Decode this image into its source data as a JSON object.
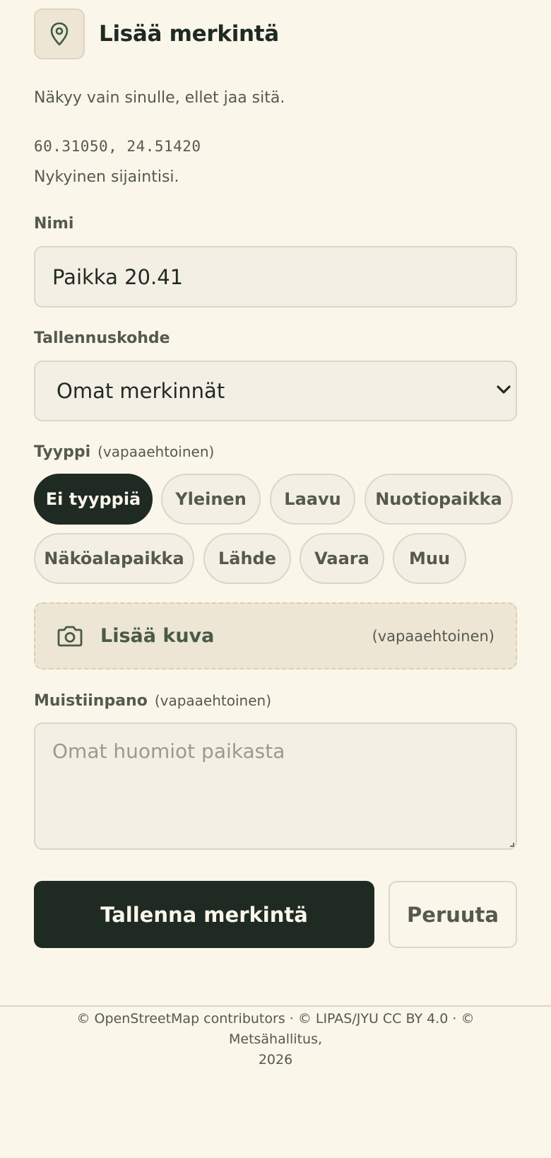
{
  "header": {
    "title": "Lisää merkintä",
    "icon": "map-pin-icon"
  },
  "description": "Näkyy vain sinulle, ellet jaa sitä.",
  "location": {
    "coords": "60.31050, 24.51420",
    "note": "Nykyinen sijaintisi."
  },
  "name_field": {
    "label": "Nimi",
    "value": "Paikka 20.41"
  },
  "target_field": {
    "label": "Tallennuskohde",
    "value": "Omat merkinnät"
  },
  "type_field": {
    "label": "Tyyppi",
    "optional": "(vapaaehtoinen)",
    "options": [
      "Ei tyyppiä",
      "Yleinen",
      "Laavu",
      "Nuotiopaikka",
      "Näköalapaikka",
      "Lähde",
      "Vaara",
      "Muu"
    ],
    "selected": "Ei tyyppiä"
  },
  "photo": {
    "label": "Lisää kuva",
    "optional": "(vapaaehtoinen)",
    "icon": "camera-icon"
  },
  "note_field": {
    "label": "Muistiinpano",
    "optional": "(vapaaehtoinen)",
    "placeholder": "Omat huomiot paikasta"
  },
  "actions": {
    "save": "Tallenna merkintä",
    "cancel": "Peruuta"
  },
  "footer": {
    "attribution_line1": "© OpenStreetMap contributors · © LIPAS/JYU CC BY 4.0 · © Metsähallitus,",
    "attribution_line2": "2026"
  },
  "colors": {
    "background": "#faf6ea",
    "primary": "#1f2a23",
    "field": "#f4efe4",
    "border": "#ddd6c4"
  }
}
